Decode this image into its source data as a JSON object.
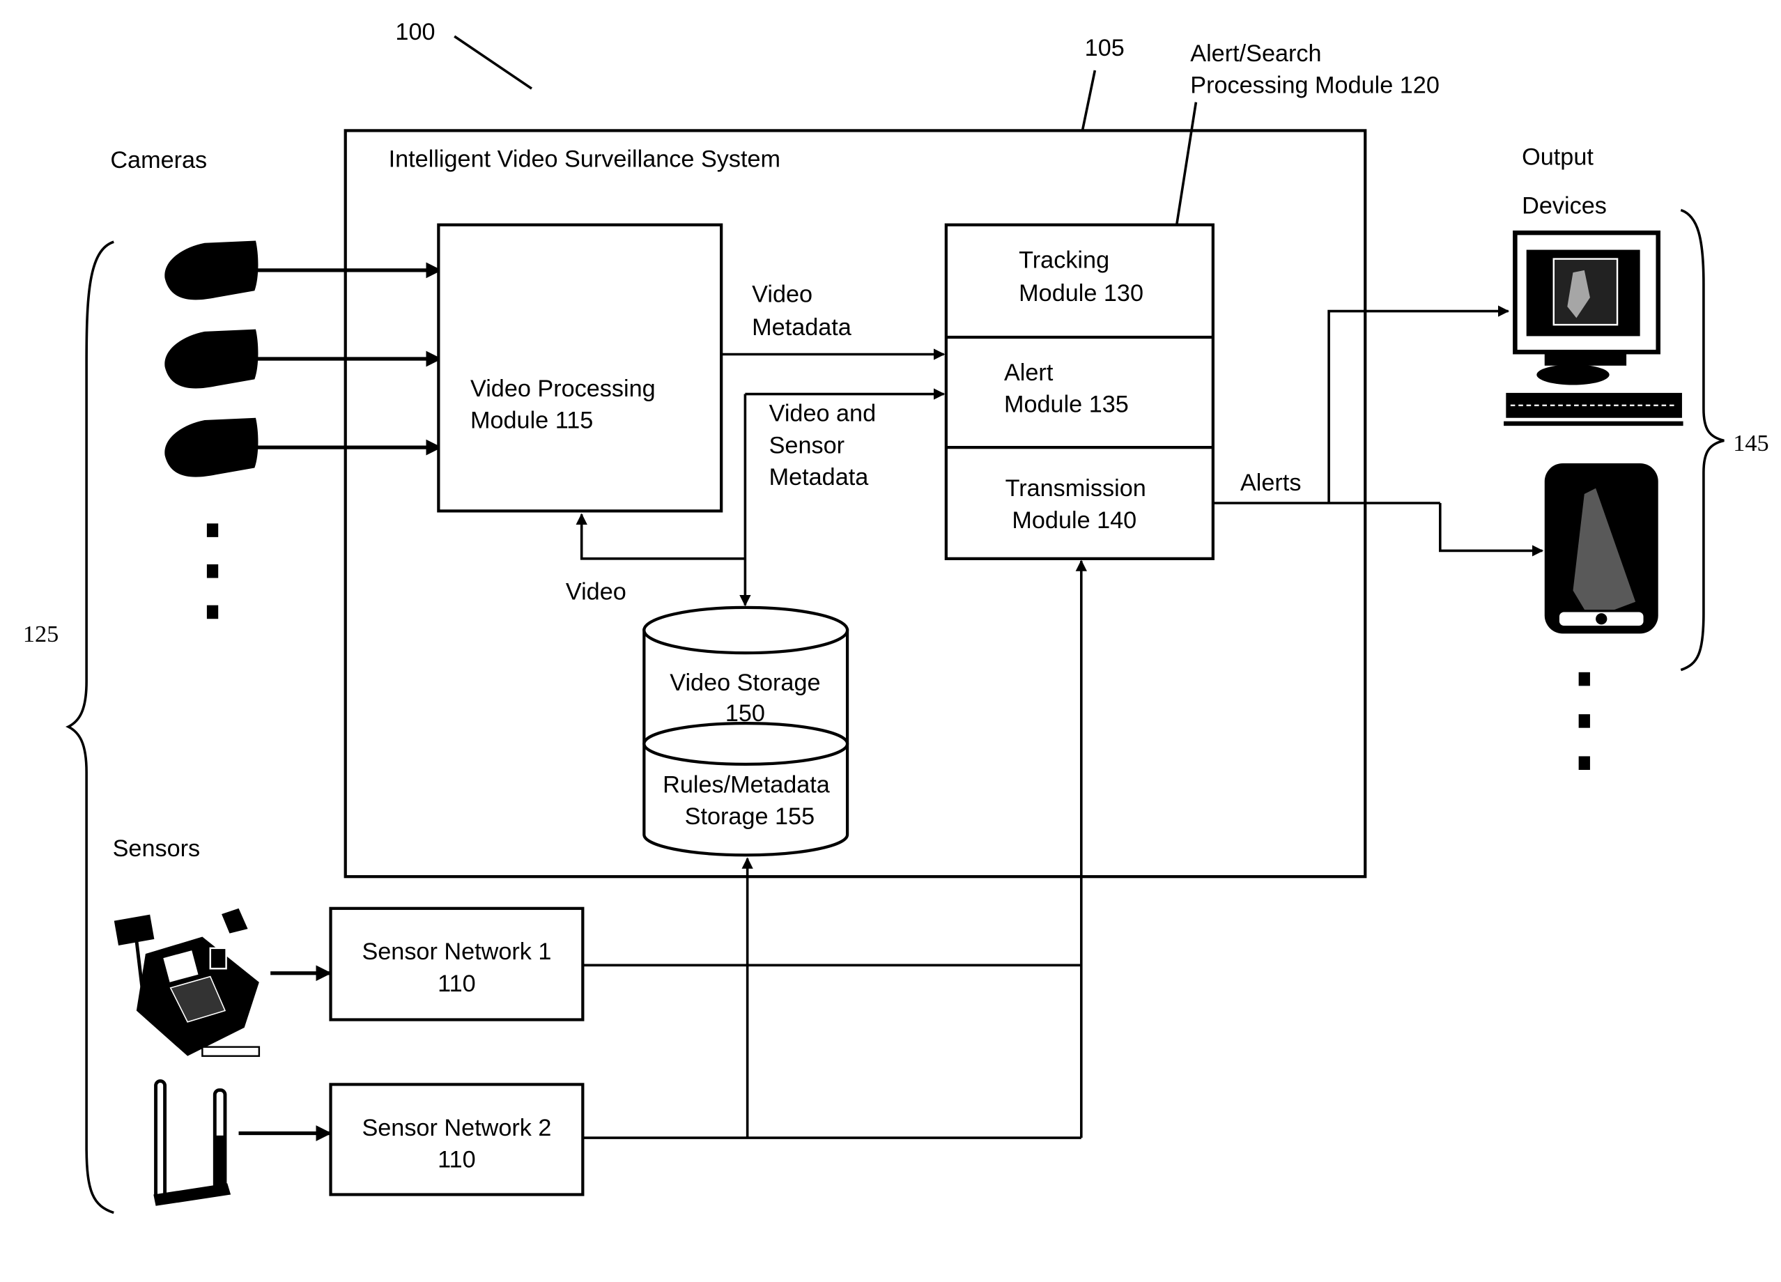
{
  "figure": {
    "ref_system": "100",
    "ref_box": "105",
    "ref_inputs": "125",
    "ref_outputs": "145",
    "system_title": "Intelligent Video Surveillance System",
    "alert_search_module": [
      "Alert/Search",
      "Processing Module 120"
    ]
  },
  "inputs": {
    "cameras_label": "Cameras",
    "sensors_label": "Sensors",
    "camera_count_shown": 3
  },
  "modules": {
    "video_processing": [
      "Video Processing",
      "Module 115"
    ],
    "tracking": [
      "Tracking",
      "Module 130"
    ],
    "alert": [
      "Alert",
      "Module 135"
    ],
    "transmission": [
      "Transmission",
      "Module 140"
    ],
    "video_storage": [
      "Video Storage",
      "150"
    ],
    "rules_storage": [
      "Rules/Metadata",
      "Storage 155"
    ],
    "sensor_network_1": [
      "Sensor Network 1",
      "110"
    ],
    "sensor_network_2": [
      "Sensor Network 2",
      "110"
    ]
  },
  "flows": {
    "video_metadata": [
      "Video",
      "Metadata"
    ],
    "video_sensor_metadata": [
      "Video and",
      "Sensor",
      "Metadata"
    ],
    "video": "Video",
    "alerts": "Alerts"
  },
  "outputs": {
    "label": [
      "Output",
      "Devices"
    ]
  }
}
